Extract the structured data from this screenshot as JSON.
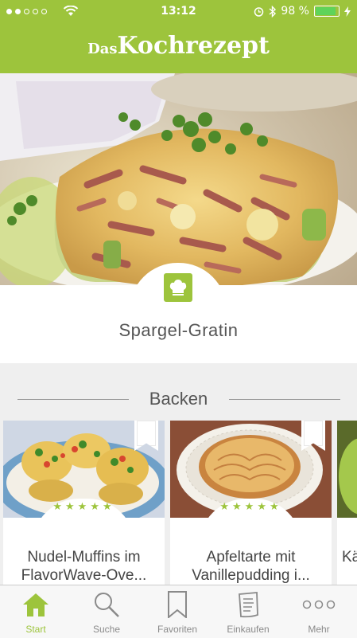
{
  "status_bar": {
    "signal_dots_filled": 2,
    "signal_dots_total": 5,
    "time": "13:12",
    "battery_percent": "98 %",
    "battery_level": 0.98
  },
  "header": {
    "logo_small": "Das",
    "logo_big": "Kochrezept"
  },
  "hero": {
    "title": "Spargel-Gratin",
    "badge_icon": "chef-hat-icon"
  },
  "section": {
    "title": "Backen"
  },
  "cards": [
    {
      "title_line1": "Nudel-Muffins im",
      "title_line2": "FlavorWave-Ove...",
      "stars": "★★★★★"
    },
    {
      "title_line1": "Apfeltarte mit",
      "title_line2": "Vanillepudding i...",
      "stars": "★★★★★"
    },
    {
      "title_line1": "Kä",
      "title_line2": "",
      "stars": ""
    }
  ],
  "tabs": [
    {
      "label": "Start",
      "icon": "home-icon",
      "active": true
    },
    {
      "label": "Suche",
      "icon": "search-icon",
      "active": false
    },
    {
      "label": "Favoriten",
      "icon": "bookmark-icon",
      "active": false
    },
    {
      "label": "Einkaufen",
      "icon": "shopping-list-icon",
      "active": false
    },
    {
      "label": "Mehr",
      "icon": "more-icon",
      "active": false
    }
  ],
  "colors": {
    "brand_green": "#9dc43c",
    "tab_inactive": "#8a8a8a"
  }
}
